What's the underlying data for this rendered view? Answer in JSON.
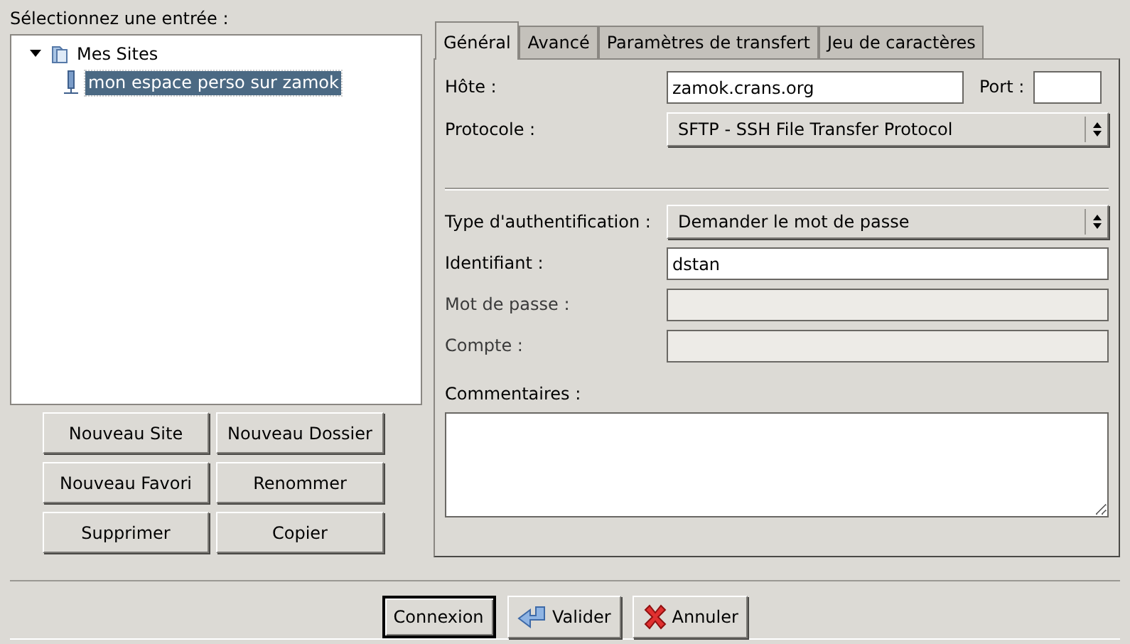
{
  "prompt": "Sélectionnez une entrée :",
  "tree": [
    {
      "label": "Mes Sites",
      "kind": "folder",
      "expanded": true,
      "selected": false,
      "children": [
        {
          "label": "mon espace perso sur zamok",
          "kind": "site",
          "selected": true
        }
      ]
    }
  ],
  "site_buttons": [
    "Nouveau Site",
    "Nouveau Dossier",
    "Nouveau Favori",
    "Renommer",
    "Supprimer",
    "Copier"
  ],
  "tabs": [
    {
      "label": "Général",
      "selected": true
    },
    {
      "label": "Avancé",
      "selected": false
    },
    {
      "label": "Paramètres de transfert",
      "selected": false
    },
    {
      "label": "Jeu de caractères",
      "selected": false
    }
  ],
  "host": {
    "label": "Hôte :",
    "value": "zamok.crans.org"
  },
  "port": {
    "label": "Port :"
  },
  "protocol": {
    "label": "Protocole :",
    "value": "SFTP - SSH File Transfer Protocol"
  },
  "auth_type": {
    "label": "Type d'authentification :",
    "value": "Demander le mot de passe"
  },
  "fields": [
    {
      "label": "Identifiant :",
      "value": "dstan",
      "disabled": false
    },
    {
      "label": "Mot de passe :",
      "disabled": true
    },
    {
      "label": "Compte :",
      "disabled": true
    }
  ],
  "comments": {
    "label": "Commentaires :"
  },
  "footer_buttons": [
    {
      "label": "Connexion",
      "kind": "plain",
      "default": true
    },
    {
      "label": "Valider",
      "kind": "arrow",
      "default": false
    },
    {
      "label": "Annuler",
      "kind": "cross",
      "default": false
    }
  ]
}
